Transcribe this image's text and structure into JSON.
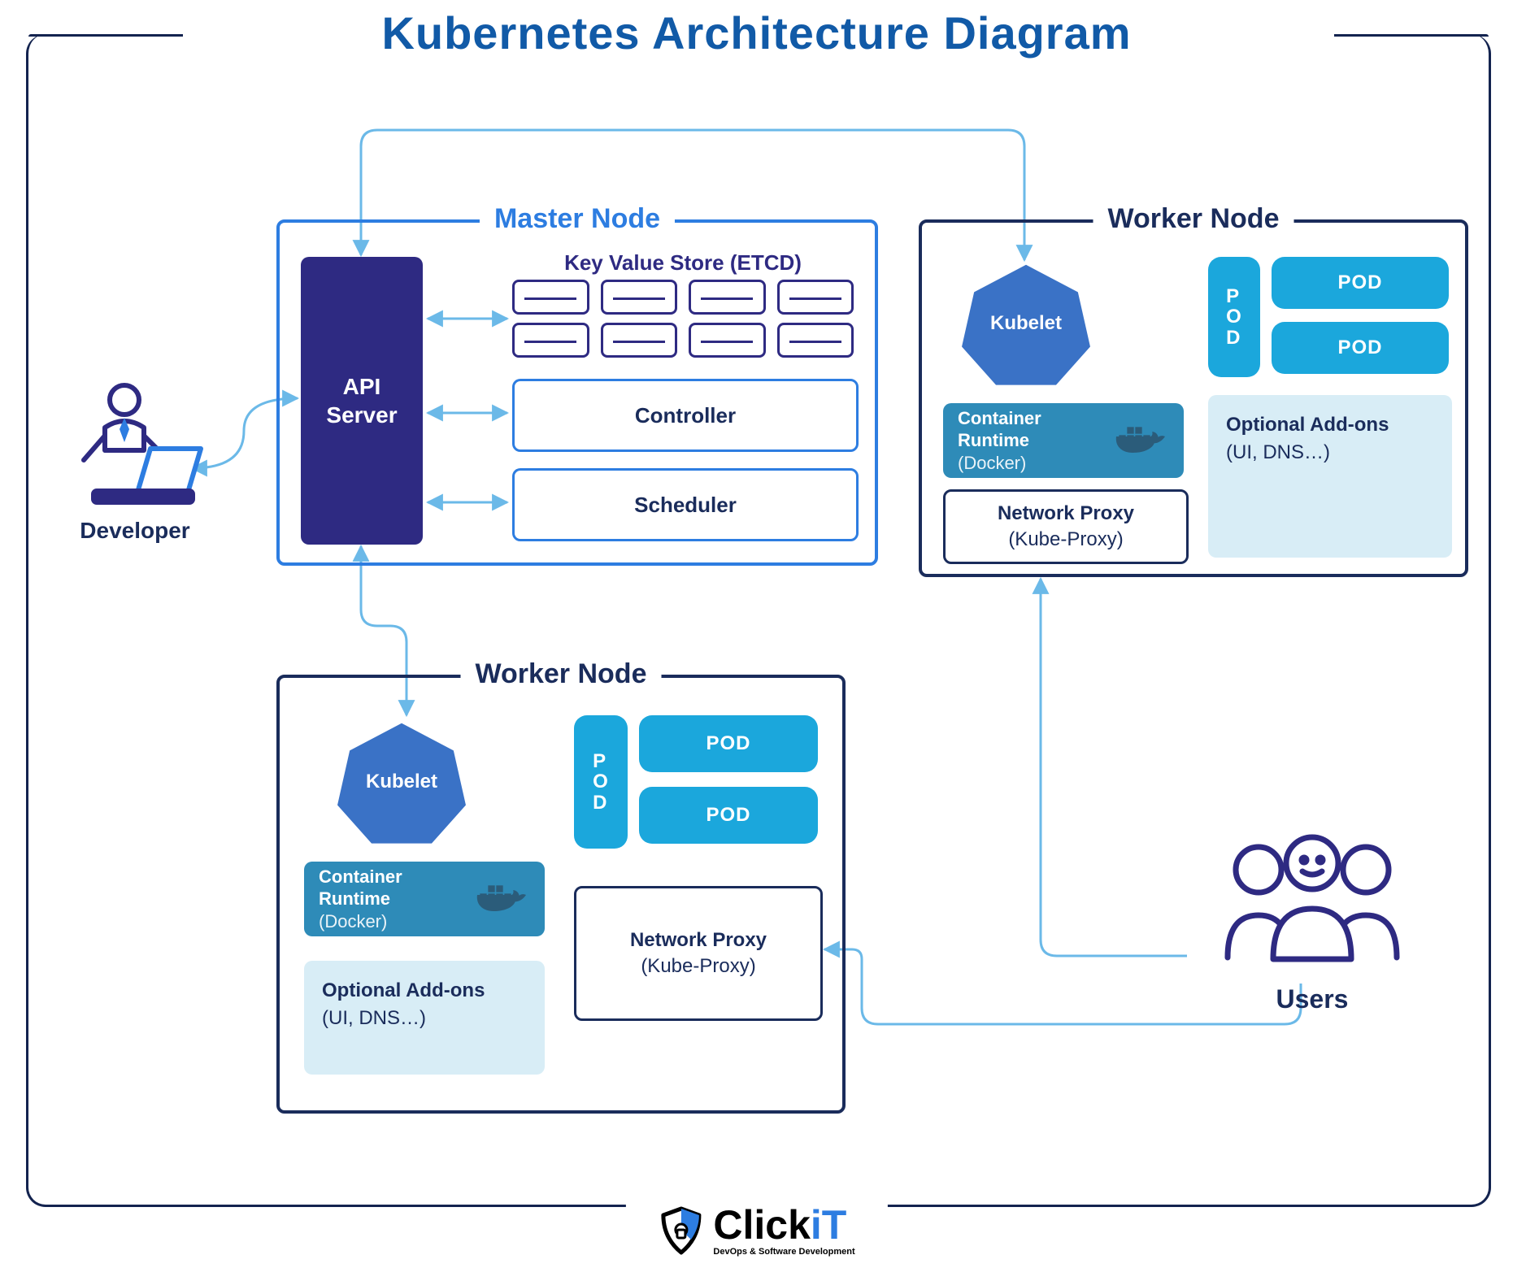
{
  "title": "Kubernetes Architecture Diagram",
  "developer_label": "Developer",
  "users_label": "Users",
  "master": {
    "label": "Master Node",
    "api_server": "API\nServer",
    "etcd_label": "Key Value Store (ETCD)",
    "controller": "Controller",
    "scheduler": "Scheduler"
  },
  "worker_top": {
    "label": "Worker Node",
    "kubelet": "Kubelet",
    "runtime_title": "Container Runtime",
    "runtime_sub": "(Docker)",
    "netproxy_title": "Network Proxy",
    "netproxy_sub": "(Kube-Proxy)",
    "pod_v": "POD",
    "pod_1": "POD",
    "pod_2": "POD",
    "addons_title": "Optional Add-ons",
    "addons_sub": "(UI, DNS…)"
  },
  "worker_bottom": {
    "label": "Worker Node",
    "kubelet": "Kubelet",
    "runtime_title": "Container Runtime",
    "runtime_sub": "(Docker)",
    "netproxy_title": "Network Proxy",
    "netproxy_sub": "(Kube-Proxy)",
    "pod_v": "POD",
    "pod_1": "POD",
    "pod_2": "POD",
    "addons_title": "Optional Add-ons",
    "addons_sub": "(UI, DNS…)"
  },
  "logo": {
    "brand_a": "Click",
    "brand_b": "iT",
    "tagline": "DevOps & Software Development"
  },
  "colors": {
    "title": "#115aa7",
    "dark_navy": "#1a2c5b",
    "blue": "#2d7de1",
    "purple": "#2e2a82",
    "cyan": "#1ba7dc",
    "teal": "#2e8bb8",
    "light_cyan": "#d8edf6",
    "arrow": "#6bb9e8"
  }
}
